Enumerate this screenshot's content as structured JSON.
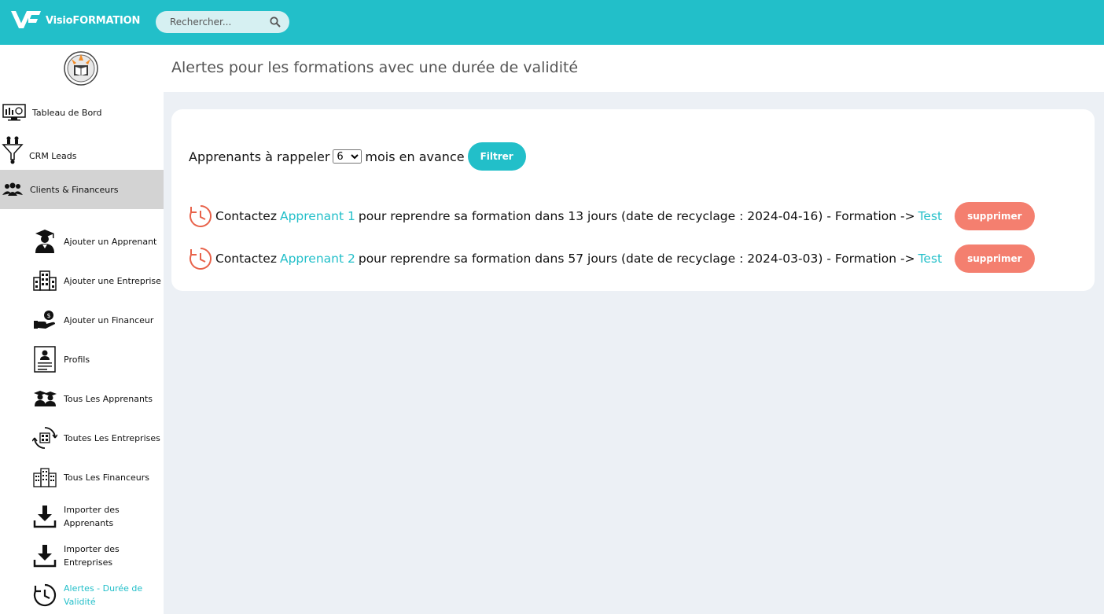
{
  "header": {
    "brand": "VisioFORMATION",
    "search_placeholder": "Rechercher..."
  },
  "sidebar": {
    "items": [
      {
        "label": "Tableau de Bord",
        "icon": "dashboard-monitor-icon"
      },
      {
        "label": "CRM Leads",
        "icon": "funnel-icon"
      },
      {
        "label": "Clients & Financeurs",
        "icon": "users-group-icon",
        "active": true
      }
    ],
    "sub_items": [
      {
        "label": "Ajouter un Apprenant",
        "icon": "graduate-icon"
      },
      {
        "label": "Ajouter une Entreprise",
        "icon": "building-icon"
      },
      {
        "label": "Ajouter un Financeur",
        "icon": "hand-money-icon"
      },
      {
        "label": "Profils",
        "icon": "profile-card-icon"
      },
      {
        "label": "Tous Les Apprenants",
        "icon": "graduates-icon"
      },
      {
        "label": "Toutes Les Entreprises",
        "icon": "company-cycle-icon"
      },
      {
        "label": "Tous Les Financeurs",
        "icon": "buildings-icon"
      },
      {
        "label": "Importer des Apprenants",
        "icon": "download-icon"
      },
      {
        "label": "Importer des Entreprises",
        "icon": "download-icon"
      },
      {
        "label": "Alertes - Durée de Validité",
        "icon": "clock-icon",
        "current": true
      }
    ]
  },
  "page": {
    "title": "Alertes pour les formations avec une durée de validité"
  },
  "filter": {
    "prefix": "Apprenants à rappeler",
    "months_value": "6",
    "suffix": "mois en avance",
    "button": "Filtrer"
  },
  "alerts": [
    {
      "pre": "Contactez",
      "learner": "Apprenant 1",
      "mid": "pour reprendre sa formation dans 13 jours (date de recyclage : 2024-04-16) - Formation ->",
      "formation": "Test",
      "delete": "supprimer"
    },
    {
      "pre": "Contactez",
      "learner": "Apprenant 2",
      "mid": "pour reprendre sa formation dans 57 jours (date de recyclage : 2024-03-03) - Formation ->",
      "formation": "Test",
      "delete": "supprimer"
    }
  ],
  "colors": {
    "accent": "#22bfc9",
    "danger": "#f47f6f",
    "clock": "#e8624a"
  }
}
